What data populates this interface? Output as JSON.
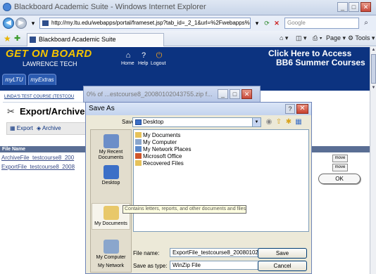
{
  "browser": {
    "title": "Blackboard Academic Suite - Windows Internet Explorer",
    "address": "http://my.ltu.edu/webapps/portal/frameset.jsp?tab_id=_2_1&url=%2Fwebapps%2f",
    "search_placeholder": "Google",
    "tab_label": "Blackboard Academic Suite",
    "commands": {
      "page": "Page",
      "tools": "Tools"
    }
  },
  "bb": {
    "logo_line1": "GET ON BOARD",
    "logo_line2": "LAWRENCE TECH",
    "nav": {
      "home": "Home",
      "help": "Help",
      "logout": "Logout"
    },
    "promo_line1": "Click Here to Access",
    "promo_line2": "BB6 Summer Courses",
    "tabs": [
      "myLTU",
      "myExtras"
    ],
    "breadcrumb": "LINDA'S TEST COURSE (TESTCOU",
    "heading": "Export/Archive",
    "actions": {
      "export": "Export",
      "archive": "Archive"
    },
    "table_header": "File Name",
    "files": [
      "ArchiveFile_testcourse8_200",
      "ExportFile_testcourse8_2008"
    ],
    "remove_label": "move",
    "ok_label": "OK"
  },
  "download": {
    "title": "0% of ...estcourse8_20080102043755.zip f..."
  },
  "save_as": {
    "title": "Save As",
    "save_in_label": "Save in:",
    "save_in_value": "Desktop",
    "places": [
      "My Recent Documents",
      "Desktop",
      "My Documents",
      "My Computer",
      "My Network"
    ],
    "files": [
      {
        "name": "My Documents",
        "icon": "folder-icon"
      },
      {
        "name": "My Computer",
        "icon": "computer-icon"
      },
      {
        "name": "My Network Places",
        "icon": "network-icon"
      },
      {
        "name": "Microsoft Office",
        "icon": "office-icon"
      },
      {
        "name": "Recovered Files",
        "icon": "folder-icon"
      }
    ],
    "tooltip": "Contains letters, reports, and other documents and files.",
    "file_name_label": "File name:",
    "file_name_value": "ExportFile_testcourse8_20080102043755",
    "save_type_label": "Save as type:",
    "save_type_value": "WinZip File",
    "save_button": "Save",
    "cancel_button": "Cancel"
  }
}
